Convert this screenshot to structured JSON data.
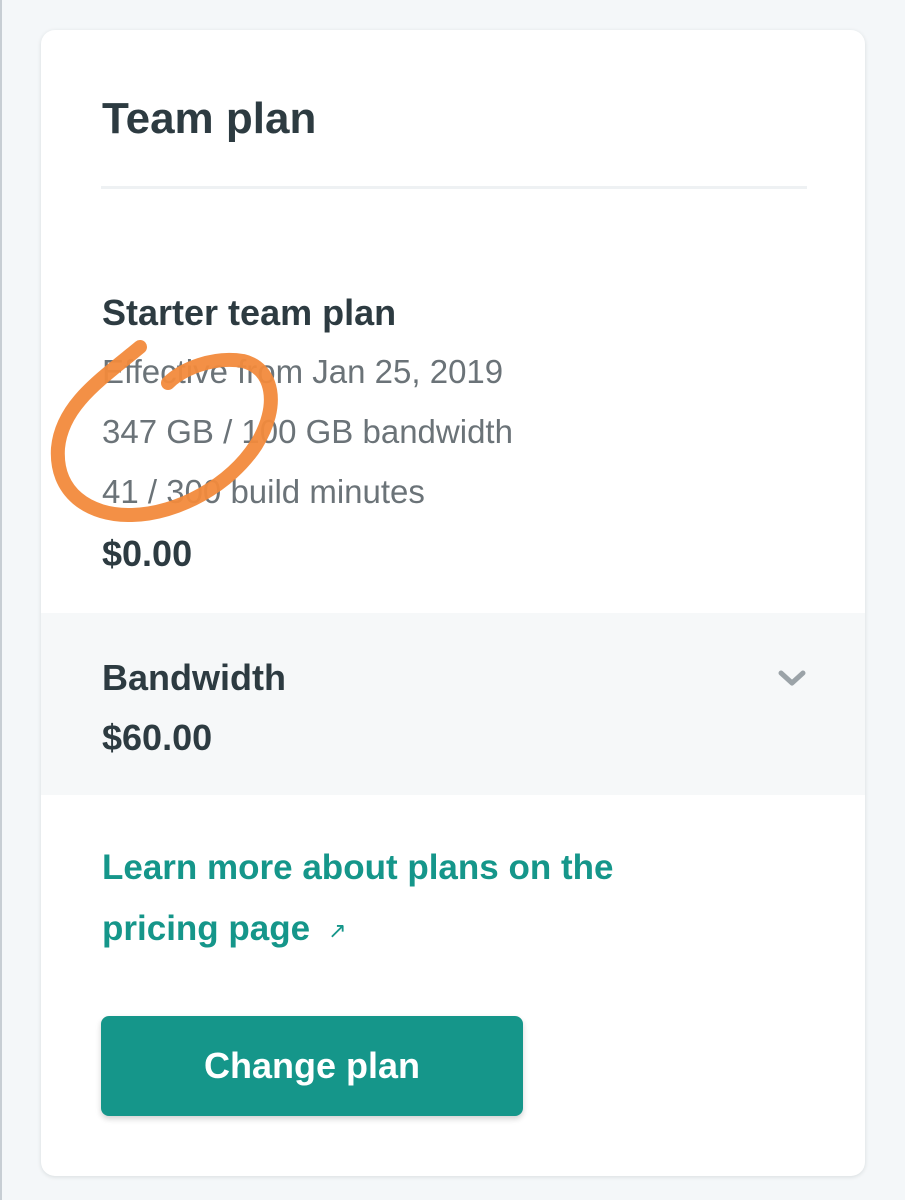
{
  "card": {
    "title": "Team plan"
  },
  "plan": {
    "name": "Starter team plan",
    "effective": "Effective from Jan 25, 2019",
    "bandwidth": "347 GB / 100 GB bandwidth",
    "build_minutes": "41 / 300 build minutes",
    "price": "$0.00"
  },
  "addon": {
    "name": "Bandwidth",
    "price": "$60.00",
    "icon": "chevron-down-icon"
  },
  "links": {
    "pricing": "Learn more about plans on the pricing page",
    "pricing_icon": "external-arrow-icon"
  },
  "actions": {
    "change_plan": "Change plan"
  },
  "colors": {
    "accent": "#15968a",
    "annotation": "#f28a3c",
    "text_dark": "#2d3b41",
    "text_muted": "#6b7378"
  }
}
